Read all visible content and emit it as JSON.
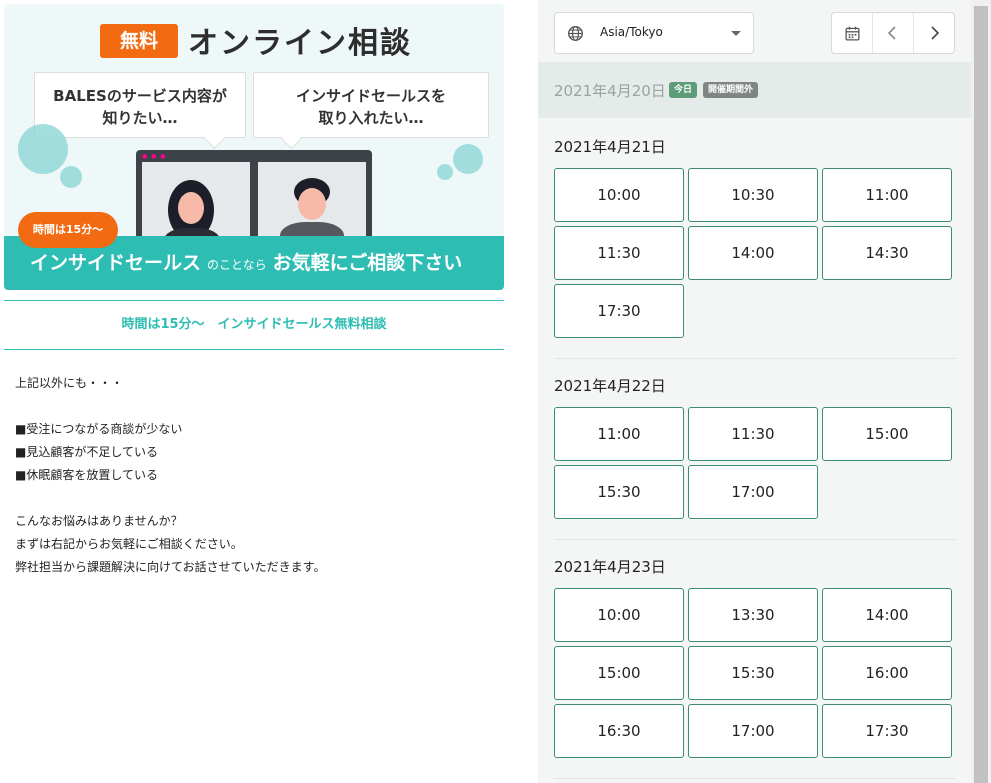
{
  "banner": {
    "free_badge": "無料",
    "headline": "オンライン相談",
    "bubble1_line1": "BALESのサービス内容が",
    "bubble1_line2": "知りたい…",
    "bubble2_line1": "インサイドセールスを",
    "bubble2_line2": "取り入れたい…",
    "time_badge": "時間は15分〜",
    "bar_main": "インサイドセールス",
    "bar_small": "のことなら",
    "bar_end": "お気軽にご相談下さい"
  },
  "subtitle": "時間は15分〜　インサイドセールス無料相談",
  "description": [
    "上記以外にも・・・",
    "",
    "■受注につながる商談が少ない",
    "■見込顧客が不足している",
    "■休眠顧客を放置している",
    "",
    "こんなお悩みはありませんか？",
    "まずは右記からお気軽にご相談ください。",
    "弊社担当から課題解決に向けてお話させていただきます。"
  ],
  "scheduler": {
    "timezone": "Asia/Tokyo",
    "today": {
      "date": "2021年4月20日",
      "today_badge": "今日",
      "closed_badge": "開催期間外"
    },
    "days": [
      {
        "date": "2021年4月21日",
        "slots": [
          "10:00",
          "10:30",
          "11:00",
          "11:30",
          "14:00",
          "14:30",
          "17:30"
        ]
      },
      {
        "date": "2021年4月22日",
        "slots": [
          "11:00",
          "11:30",
          "15:00",
          "15:30",
          "17:00"
        ]
      },
      {
        "date": "2021年4月23日",
        "slots": [
          "10:00",
          "13:30",
          "14:00",
          "15:00",
          "15:30",
          "16:00",
          "16:30",
          "17:00",
          "17:30"
        ]
      }
    ]
  },
  "colors": {
    "accent_teal": "#2ebdb2",
    "slot_border": "#3c8d74",
    "badge_orange": "#f26b12",
    "today_badge": "#5d9c78"
  },
  "icons": {
    "timezone": "globe-icon",
    "calendar": "calendar-icon",
    "prev": "chevron-left-icon",
    "next": "chevron-right-icon",
    "dropdown": "chevron-down-icon"
  }
}
